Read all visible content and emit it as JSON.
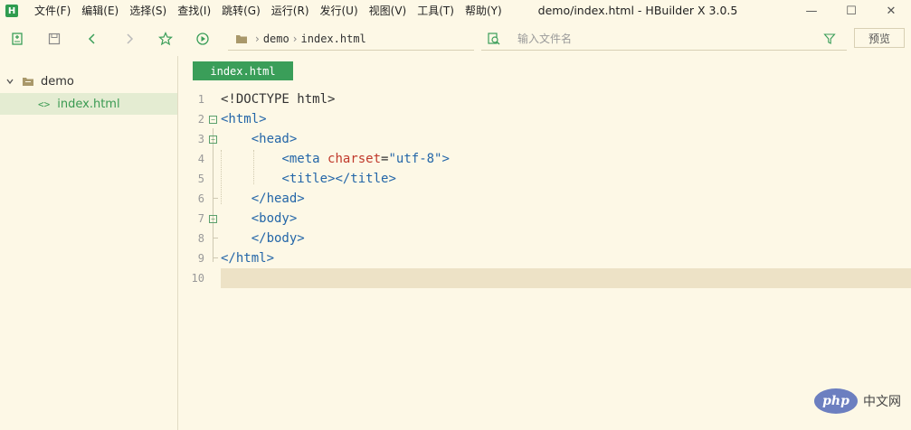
{
  "app": {
    "logo_letter": "H",
    "window_title": "demo/index.html - HBuilder X 3.0.5",
    "brand_color": "#2f9c4f"
  },
  "menu": [
    {
      "label": "文件(F)"
    },
    {
      "label": "编辑(E)"
    },
    {
      "label": "选择(S)"
    },
    {
      "label": "查找(I)"
    },
    {
      "label": "跳转(G)"
    },
    {
      "label": "运行(R)"
    },
    {
      "label": "发行(U)"
    },
    {
      "label": "视图(V)"
    },
    {
      "label": "工具(T)"
    },
    {
      "label": "帮助(Y)"
    }
  ],
  "window_controls": {
    "minimize": "—",
    "maximize": "☐",
    "close": "✕"
  },
  "toolbar": {
    "breadcrumb": [
      "demo",
      "index.html"
    ],
    "search_placeholder": "输入文件名",
    "preview_label": "预览",
    "icons": [
      "new-file-icon",
      "save-icon",
      "back-icon",
      "forward-icon",
      "star-icon",
      "run-icon",
      "folder-icon",
      "file-search-icon",
      "filter-icon"
    ]
  },
  "sidebar": {
    "project": {
      "name": "demo",
      "expanded": true
    },
    "files": [
      {
        "name": "index.html",
        "icon": "<>",
        "active": true
      }
    ]
  },
  "editor": {
    "tab_label": "index.html",
    "tab_color": "#3a9e59",
    "line_numbers": [
      "1",
      "2",
      "3",
      "4",
      "5",
      "6",
      "7",
      "8",
      "9",
      "10"
    ],
    "current_line": 10
  }
}
